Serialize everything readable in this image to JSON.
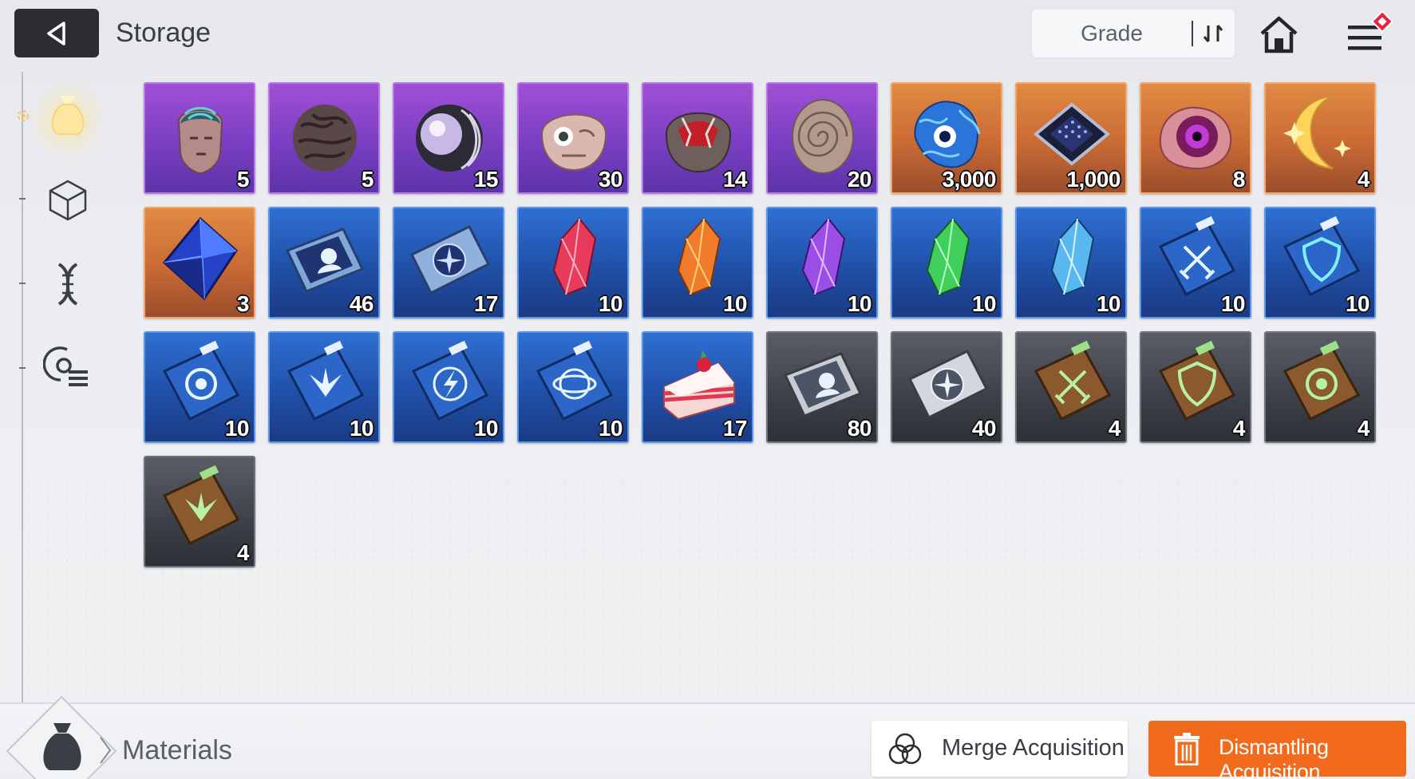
{
  "header": {
    "back_icon": "back-arrow-icon",
    "title": "Storage",
    "sort_label": "Grade",
    "sort_icon": "sort-toggle-icon",
    "home_icon": "home-icon",
    "menu_icon": "menu-icon",
    "menu_badge_color": "#e8223a"
  },
  "sidebar": {
    "items": [
      {
        "icon": "materials-bag-icon",
        "active": true
      },
      {
        "icon": "cube-icon",
        "active": false
      },
      {
        "icon": "dna-icon",
        "active": false
      },
      {
        "icon": "module-list-icon",
        "active": false
      }
    ]
  },
  "colors": {
    "purple": "#7a3ec2",
    "orange": "#c96a34",
    "blue": "#2050a8",
    "gray": "#3d4048",
    "accent": "#f26a1b"
  },
  "items": [
    {
      "icon": "brain-head-icon",
      "grade": "purple",
      "qty": "5"
    },
    {
      "icon": "brain-icon",
      "grade": "purple",
      "qty": "5"
    },
    {
      "icon": "orb-shell-icon",
      "grade": "purple",
      "qty": "15"
    },
    {
      "icon": "skull-eye-icon",
      "grade": "purple",
      "qty": "30"
    },
    {
      "icon": "cracked-skull-icon",
      "grade": "purple",
      "qty": "14"
    },
    {
      "icon": "spiral-shell-icon",
      "grade": "purple",
      "qty": "20"
    },
    {
      "icon": "blue-eye-creature-icon",
      "grade": "orange",
      "qty": "3,000"
    },
    {
      "icon": "chip-icon",
      "grade": "orange",
      "qty": "1,000"
    },
    {
      "icon": "purple-eye-icon",
      "grade": "orange",
      "qty": "8"
    },
    {
      "icon": "golden-moon-icon",
      "grade": "orange",
      "qty": "4"
    },
    {
      "icon": "blue-crystal-cube-icon",
      "grade": "orange",
      "qty": "3"
    },
    {
      "icon": "id-card-icon",
      "grade": "blue",
      "qty": "46"
    },
    {
      "icon": "compass-card-icon",
      "grade": "blue",
      "qty": "17"
    },
    {
      "icon": "red-crystal-icon",
      "grade": "blue",
      "qty": "10"
    },
    {
      "icon": "orange-crystal-icon",
      "grade": "blue",
      "qty": "10"
    },
    {
      "icon": "purple-crystal-icon",
      "grade": "blue",
      "qty": "10"
    },
    {
      "icon": "green-crystal-icon",
      "grade": "blue",
      "qty": "10"
    },
    {
      "icon": "cyan-crystal-icon",
      "grade": "blue",
      "qty": "10"
    },
    {
      "icon": "sword-manual-icon",
      "grade": "blue",
      "qty": "10"
    },
    {
      "icon": "shield-manual-icon",
      "grade": "blue",
      "qty": "10"
    },
    {
      "icon": "eye-manual-icon",
      "grade": "blue",
      "qty": "10"
    },
    {
      "icon": "wing-manual-icon",
      "grade": "blue",
      "qty": "10"
    },
    {
      "icon": "bolt-manual-icon",
      "grade": "blue",
      "qty": "10"
    },
    {
      "icon": "orbit-manual-icon",
      "grade": "blue",
      "qty": "10"
    },
    {
      "icon": "cake-icon",
      "grade": "blue",
      "qty": "17"
    },
    {
      "icon": "id-card-icon",
      "grade": "gray",
      "qty": "80"
    },
    {
      "icon": "compass-card-icon",
      "grade": "gray",
      "qty": "40"
    },
    {
      "icon": "sword-manual-icon",
      "grade": "gray",
      "qty": "4"
    },
    {
      "icon": "shield-manual-icon",
      "grade": "gray",
      "qty": "4"
    },
    {
      "icon": "eye-manual-icon",
      "grade": "gray",
      "qty": "4"
    },
    {
      "icon": "wing-manual-icon",
      "grade": "gray",
      "qty": "4"
    }
  ],
  "footer": {
    "category_icon": "materials-bag-icon",
    "category_label": "Materials",
    "merge_label": "Merge Acquisition",
    "merge_icon": "merge-icon",
    "dismantle_label": "Dismantling Acquisition",
    "dismantle_icon": "trash-icon"
  }
}
